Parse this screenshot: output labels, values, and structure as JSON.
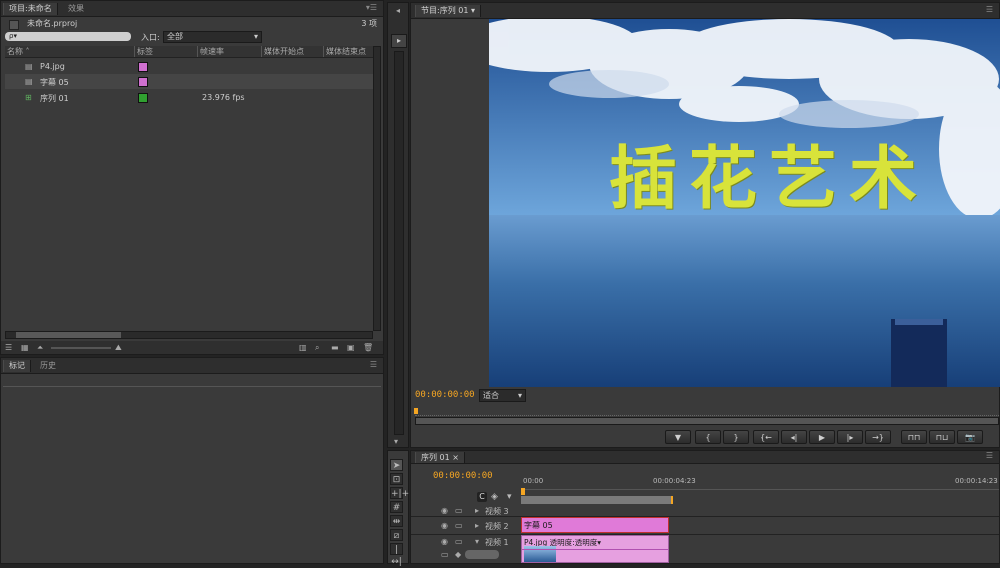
{
  "project_panel": {
    "tab_project": "项目:未命名",
    "tab_effects": "效果",
    "filename": "未命名.prproj",
    "item_count": "3 项",
    "search_placeholder": "ρ▾",
    "in_label": "入口:",
    "in_value": "全部",
    "columns": [
      "名称",
      "标签",
      "帧速率",
      "媒体开始点",
      "媒体结束点"
    ],
    "items": [
      {
        "name": "P4.jpg",
        "icon": "image-icon",
        "label_color": "#d070d0",
        "fps": ""
      },
      {
        "name": "字幕 05",
        "icon": "title-icon",
        "label_color": "#d070d0",
        "fps": ""
      },
      {
        "name": "序列 01",
        "icon": "sequence-icon",
        "label_color": "#30a030",
        "fps": "23.976 fps"
      }
    ]
  },
  "markers_panel": {
    "tab_markers": "标记",
    "tab_history": "历史"
  },
  "program_monitor": {
    "tab": "节目:序列 01",
    "timecode": "00:00:00:00",
    "fit": "适合",
    "title_text": "插花艺术",
    "accent": "#f5a623"
  },
  "timeline": {
    "tab": "序列 01",
    "timecode": "00:00:00:00",
    "ruler": [
      "00:00",
      "00:00:04:23",
      "00:00:14:23"
    ],
    "tracks": [
      {
        "name": "视频 3"
      },
      {
        "name": "视频 2",
        "clip": "字幕 05"
      },
      {
        "name": "视频 1",
        "clip": "P4.jpg  透明度:透明度▾"
      }
    ]
  }
}
